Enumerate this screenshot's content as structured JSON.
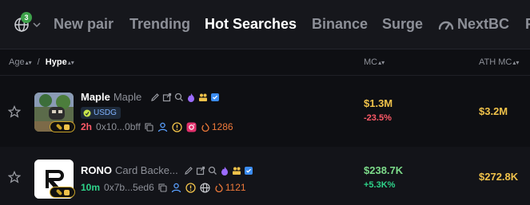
{
  "nav": {
    "chain_badge": "3",
    "tabs": [
      "New pair",
      "Trending",
      "Hot Searches",
      "Binance",
      "Surge",
      "NextBC",
      "F"
    ],
    "active_tab": "Hot Searches"
  },
  "columns": {
    "age": "Age",
    "separator": "/",
    "hype": "Hype",
    "mc": "MC",
    "ath_mc": "ATH MC"
  },
  "rows": [
    {
      "symbol": "Maple",
      "name": "Maple",
      "quote": "USDG",
      "age": "2h",
      "address": "0x10...0bff",
      "hype": "1286",
      "mc": "$1.3M",
      "change": "-23.5%",
      "ath_mc": "$3.2M"
    },
    {
      "symbol": "RONO",
      "name": "Card Backe...",
      "age": "10m",
      "address": "0x7b...5ed6",
      "hype": "1121",
      "mc": "$238.7K",
      "change": "+5.3K%",
      "ath_mc": "$272.8K"
    }
  ],
  "colors": {
    "background": "#0e0f13",
    "gold": "#f0c24a",
    "green": "#2ed48a",
    "red": "#ff5a68",
    "hype": "#f07a3a"
  }
}
